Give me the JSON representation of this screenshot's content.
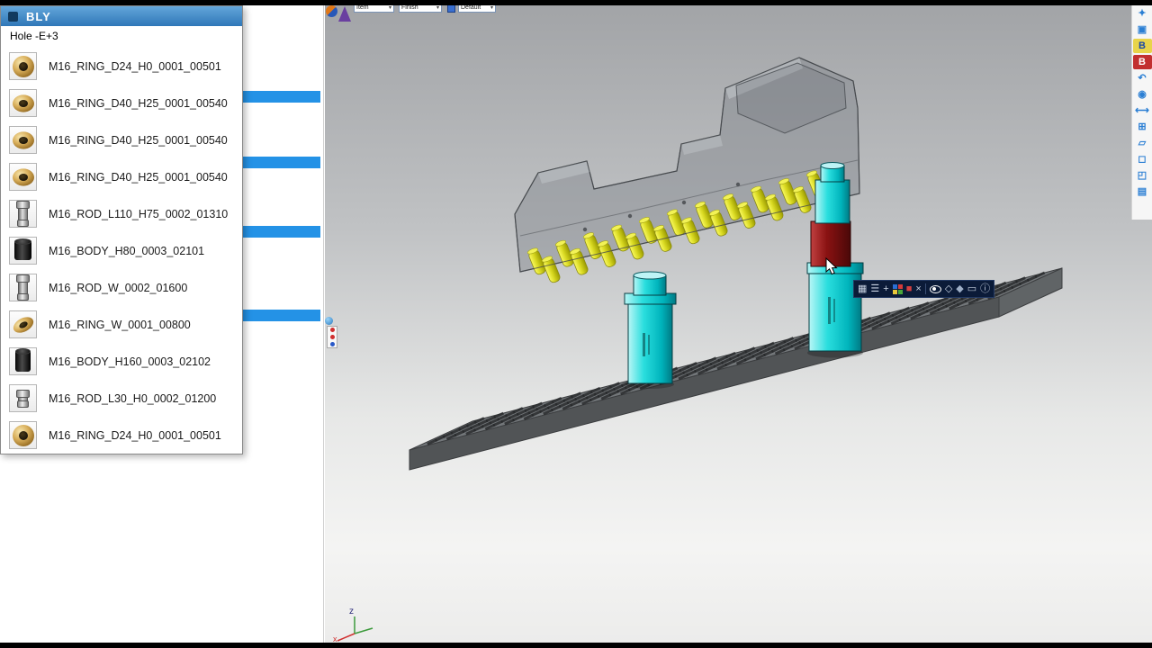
{
  "popup": {
    "title": "BLY",
    "subtitle": "Hole -E+3",
    "items": [
      {
        "icon": "ring",
        "label": "M16_RING_D24_H0_0001_00501"
      },
      {
        "icon": "ring-flat",
        "label": "M16_RING_D40_H25_0001_00540"
      },
      {
        "icon": "ring-flat",
        "label": "M16_RING_D40_H25_0001_00540"
      },
      {
        "icon": "ring-flat",
        "label": "M16_RING_D40_H25_0001_00540"
      },
      {
        "icon": "rod",
        "label": "M16_ROD_L110_H75_0002_01310"
      },
      {
        "icon": "body",
        "label": "M16_BODY_H80_0003_02101"
      },
      {
        "icon": "rod",
        "label": "M16_ROD_W_0002_01600"
      },
      {
        "icon": "ring-tilt",
        "label": "M16_RING_W_0001_00800"
      },
      {
        "icon": "body-tall",
        "label": "M16_BODY_H160_0003_02102"
      },
      {
        "icon": "rod-small",
        "label": "M16_ROD_L30_H0_0002_01200"
      },
      {
        "icon": "ring",
        "label": "M16_RING_D24_H0_0001_00501"
      }
    ]
  },
  "sidebar": {
    "selection_bar_tops": [
      101,
      174,
      251,
      344
    ]
  },
  "viewport_toolbar": {
    "item_combo": "Item",
    "finish_combo": "Finish",
    "default_combo": "Default"
  },
  "right_toolbar": {
    "icons": [
      {
        "name": "select-tool-icon",
        "glyph": "✦",
        "color": "#2b7fd4"
      },
      {
        "name": "open-folder-icon",
        "glyph": "▣",
        "color": "#2b7fd4"
      },
      {
        "name": "bom-yellow-icon",
        "glyph": "B",
        "color": "#1a49a8",
        "bg": "#e8d44a"
      },
      {
        "name": "bom-red-icon",
        "glyph": "B",
        "color": "#ffffff",
        "bg": "#c23030"
      },
      {
        "name": "undo-icon",
        "glyph": "↶",
        "color": "#2b7fd4"
      },
      {
        "name": "light-icon",
        "glyph": "◉",
        "color": "#2b7fd4"
      },
      {
        "name": "measure-icon",
        "glyph": "⟷",
        "color": "#2b7fd4"
      },
      {
        "name": "zoom-fit-icon",
        "glyph": "⊞",
        "color": "#2b7fd4"
      },
      {
        "name": "copy-view-icon",
        "glyph": "▱",
        "color": "#2b7fd4"
      },
      {
        "name": "box-select-icon",
        "glyph": "◻",
        "color": "#2b7fd4"
      },
      {
        "name": "section-icon",
        "glyph": "◰",
        "color": "#2b7fd4"
      },
      {
        "name": "print-icon",
        "glyph": "▤",
        "color": "#2b7fd4"
      }
    ]
  },
  "mini_toolbar": {
    "icons": [
      {
        "type": "glyph",
        "name": "grid-icon",
        "glyph": "▦",
        "color": "#c8d2e2"
      },
      {
        "type": "glyph",
        "name": "list-icon",
        "glyph": "☰",
        "color": "#c8d2e2"
      },
      {
        "type": "glyph",
        "name": "add-icon",
        "glyph": "+",
        "color": "#c8d2e2"
      },
      {
        "type": "palette",
        "name": "color-set-icon"
      },
      {
        "type": "glyph",
        "name": "red-box-icon",
        "glyph": "■",
        "color": "#d44040"
      },
      {
        "type": "glyph",
        "name": "close-icon",
        "glyph": "×",
        "color": "#c8d2e2"
      },
      {
        "type": "divider",
        "name": "divider"
      },
      {
        "type": "eye",
        "name": "visibility-icon"
      },
      {
        "type": "glyph",
        "name": "wire-cube-icon",
        "glyph": "◇",
        "color": "#c8d2e2"
      },
      {
        "type": "glyph",
        "name": "solid-cube-icon",
        "glyph": "◆",
        "color": "#9fb0c8"
      },
      {
        "type": "glyph",
        "name": "frame-icon",
        "glyph": "▭",
        "color": "#c8d2e2"
      },
      {
        "type": "glyph",
        "name": "info-icon",
        "glyph": "ⓘ",
        "color": "#c8d2e2"
      }
    ],
    "palette_colors": [
      "#2b6fd4",
      "#d43a3a",
      "#e8c83a",
      "#4aa83a"
    ]
  },
  "axis": {
    "z_label": "z",
    "x_label": "x"
  },
  "colors": {
    "accent_blue": "#2492e6",
    "header_blue": "#3a85c4",
    "clamp_cyan": "#00c4cc",
    "clamp_red": "#8a1212",
    "pin_yellow": "#d8d820"
  }
}
